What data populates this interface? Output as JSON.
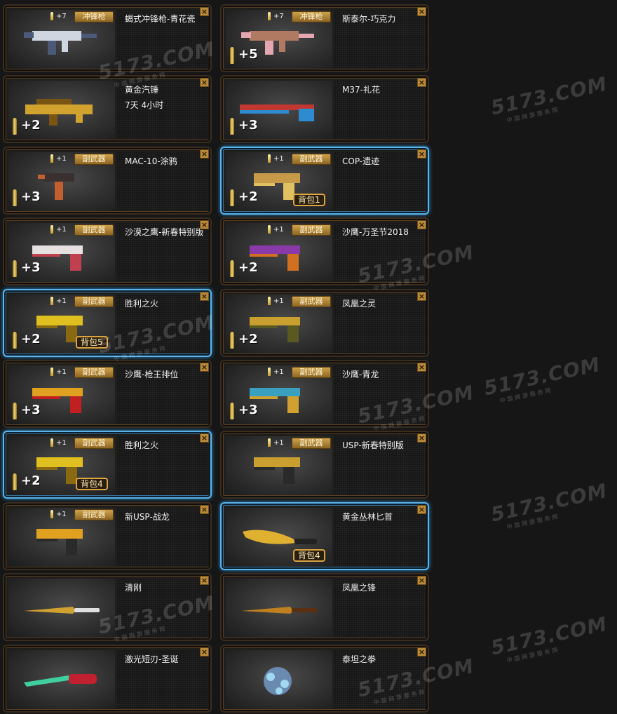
{
  "close_symbol": "×",
  "watermark": {
    "logo": "5173.COM",
    "tagline": "中国网游服务网"
  },
  "items": [
    {
      "name": "蝎式冲锋枪-青花瓷",
      "tag": "冲锋枪",
      "plus": "+7",
      "ammo": "",
      "bag": "",
      "time": "",
      "selected": false,
      "gun": "smg",
      "colors": [
        "#cfd6e0",
        "#4a5a78"
      ]
    },
    {
      "name": "斯泰尔-巧克力",
      "tag": "冲锋枪",
      "plus": "+7",
      "ammo": "+5",
      "bag": "",
      "time": "",
      "selected": false,
      "gun": "smg",
      "colors": [
        "#b07a62",
        "#e4a6b0"
      ]
    },
    {
      "name": "黄金汽锤",
      "tag": "",
      "plus": "",
      "ammo": "+2",
      "bag": "",
      "time": "7天  4小时",
      "selected": false,
      "gun": "rifle",
      "colors": [
        "#d2a22e",
        "#7a5412"
      ]
    },
    {
      "name": "M37-礼花",
      "tag": "",
      "plus": "",
      "ammo": "+3",
      "bag": "",
      "time": "",
      "selected": false,
      "gun": "shotgun",
      "colors": [
        "#c2372f",
        "#2f8bd0"
      ]
    },
    {
      "name": "MAC-10-涂鸦",
      "tag": "副武器",
      "plus": "+1",
      "ammo": "+3",
      "bag": "",
      "time": "",
      "selected": false,
      "gun": "mac",
      "colors": [
        "#3a3030",
        "#c06030"
      ]
    },
    {
      "name": "COP-遗迹",
      "tag": "副武器",
      "plus": "+1",
      "ammo": "+2",
      "bag": "背包1",
      "time": "",
      "selected": true,
      "gun": "pistol",
      "colors": [
        "#c79a4a",
        "#e0c060"
      ]
    },
    {
      "name": "沙漠之鹰-新春特别版",
      "tag": "副武器",
      "plus": "+1",
      "ammo": "+3",
      "bag": "",
      "time": "",
      "selected": false,
      "gun": "deagle",
      "colors": [
        "#e6e0e0",
        "#c04050"
      ]
    },
    {
      "name": "沙鹰-万圣节2018",
      "tag": "副武器",
      "plus": "+1",
      "ammo": "+2",
      "bag": "",
      "time": "",
      "selected": false,
      "gun": "deagle",
      "colors": [
        "#8a3aa8",
        "#d07020"
      ]
    },
    {
      "name": "胜利之火",
      "tag": "副武器",
      "plus": "+1",
      "ammo": "+2",
      "bag": "背包5",
      "time": "",
      "selected": true,
      "gun": "pistol",
      "colors": [
        "#e0c020",
        "#8a6a10"
      ]
    },
    {
      "name": "凤凰之灵",
      "tag": "副武器",
      "plus": "+1",
      "ammo": "+2",
      "bag": "",
      "time": "",
      "selected": false,
      "gun": "deagle",
      "colors": [
        "#c9a030",
        "#5a5a20"
      ]
    },
    {
      "name": "沙鹰-枪王排位",
      "tag": "副武器",
      "plus": "+1",
      "ammo": "+3",
      "bag": "",
      "time": "",
      "selected": false,
      "gun": "deagle",
      "colors": [
        "#e0a020",
        "#c02020"
      ]
    },
    {
      "name": "沙鹰-青龙",
      "tag": "副武器",
      "plus": "+1",
      "ammo": "+3",
      "bag": "",
      "time": "",
      "selected": false,
      "gun": "deagle",
      "colors": [
        "#3aa0c0",
        "#d0a030"
      ]
    },
    {
      "name": "胜利之火",
      "tag": "副武器",
      "plus": "+1",
      "ammo": "+2",
      "bag": "背包4",
      "time": "",
      "selected": true,
      "gun": "pistol",
      "colors": [
        "#e0c020",
        "#8a6a10"
      ]
    },
    {
      "name": "USP-新春特别版",
      "tag": "副武器",
      "plus": "+1",
      "ammo": "",
      "bag": "",
      "time": "",
      "selected": false,
      "gun": "pistol",
      "colors": [
        "#c9a030",
        "#2a2a2a"
      ]
    },
    {
      "name": "新USP-战龙",
      "tag": "副武器",
      "plus": "+1",
      "ammo": "",
      "bag": "",
      "time": "",
      "selected": false,
      "gun": "pistol",
      "colors": [
        "#e0a020",
        "#2a2a2a"
      ]
    },
    {
      "name": "黄金丛林匕首",
      "tag": "",
      "plus": "",
      "ammo": "",
      "bag": "背包4",
      "time": "",
      "selected": true,
      "gun": "knife",
      "colors": [
        "#e0b030",
        "#222222"
      ]
    },
    {
      "name": "清刚",
      "tag": "",
      "plus": "",
      "ammo": "",
      "bag": "",
      "time": "",
      "selected": false,
      "gun": "blade",
      "colors": [
        "#d0a030",
        "#e0e0e0"
      ]
    },
    {
      "name": "凤凰之锋",
      "tag": "",
      "plus": "",
      "ammo": "",
      "bag": "",
      "time": "",
      "selected": false,
      "gun": "blade",
      "colors": [
        "#c08020",
        "#5a3010"
      ]
    },
    {
      "name": "激光短刃-圣诞",
      "tag": "",
      "plus": "",
      "ammo": "",
      "bag": "",
      "time": "",
      "selected": false,
      "gun": "laser",
      "colors": [
        "#40d0a0",
        "#c02030"
      ]
    },
    {
      "name": "泰坦之拳",
      "tag": "",
      "plus": "",
      "ammo": "",
      "bag": "",
      "time": "",
      "selected": false,
      "gun": "fist",
      "colors": [
        "#6a8ab0",
        "#a0d8f0"
      ]
    }
  ]
}
